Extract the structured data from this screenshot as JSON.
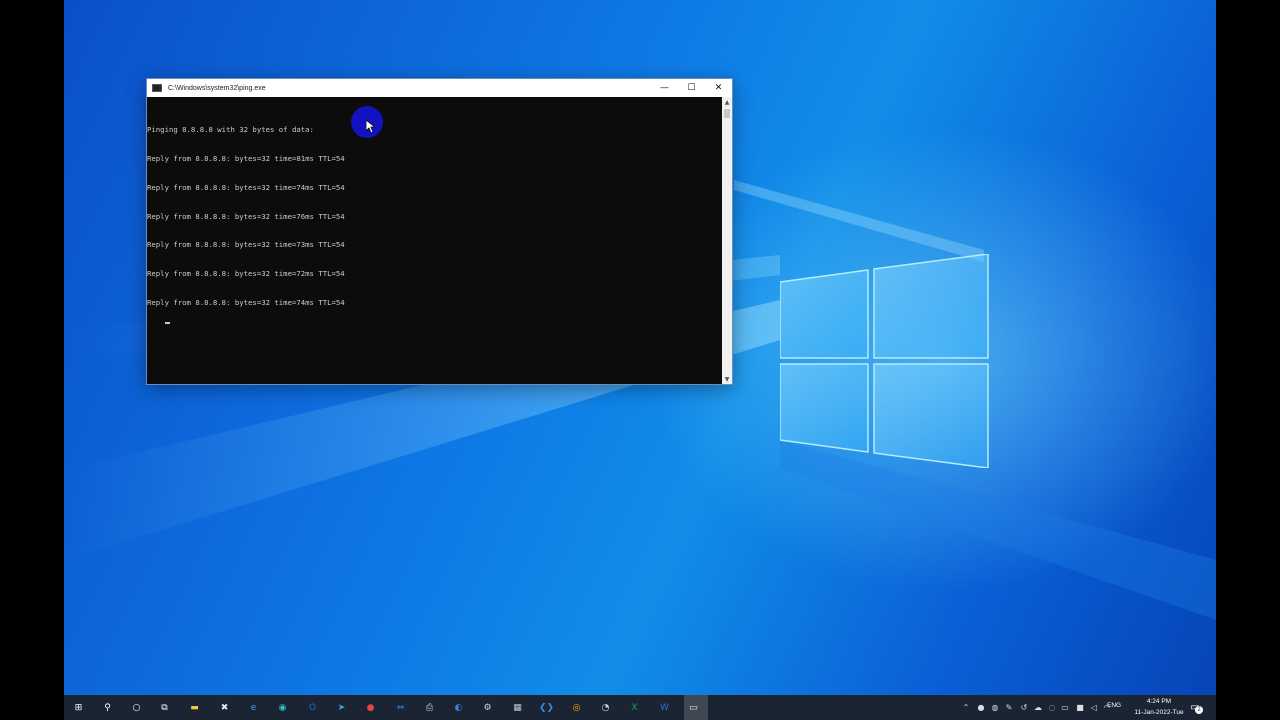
{
  "console": {
    "title": "C:\\Windows\\system32\\ping.exe",
    "minimize_glyph": "—",
    "maximize_glyph": "☐",
    "close_glyph": "✕",
    "lines": [
      "Pinging 8.8.8.8 with 32 bytes of data:",
      "Reply from 8.8.8.8: bytes=32 time=81ms TTL=54",
      "Reply from 8.8.8.8: bytes=32 time=74ms TTL=54",
      "Reply from 8.8.8.8: bytes=32 time=76ms TTL=54",
      "Reply from 8.8.8.8: bytes=32 time=73ms TTL=54",
      "Reply from 8.8.8.8: bytes=32 time=72ms TTL=54",
      "Reply from 8.8.8.8: bytes=32 time=74ms TTL=54"
    ],
    "colors": {
      "background": "#0c0c0c",
      "text": "#cccccc"
    }
  },
  "taskbar": {
    "apps": [
      {
        "name": "start-icon",
        "glyph": "⊞",
        "color": "#ffffff"
      },
      {
        "name": "search-icon",
        "glyph": "⚲",
        "color": "#ffffff"
      },
      {
        "name": "cortana-icon",
        "glyph": "○",
        "color": "#ffffff"
      },
      {
        "name": "task-view-icon",
        "glyph": "⧉",
        "color": "#ffffff"
      },
      {
        "name": "file-explorer-icon",
        "glyph": "▬",
        "color": "#f2c14e"
      },
      {
        "name": "tools-icon",
        "glyph": "✖",
        "color": "#e8e8e8"
      },
      {
        "name": "edge-legacy-icon",
        "glyph": "e",
        "color": "#3fa0ff"
      },
      {
        "name": "edge-icon",
        "glyph": "◉",
        "color": "#2bc4c9"
      },
      {
        "name": "outlook-icon",
        "glyph": "O",
        "color": "#1f6fd0"
      },
      {
        "name": "telegram-icon",
        "glyph": "➤",
        "color": "#35a7e0"
      },
      {
        "name": "recorder-icon",
        "glyph": "●",
        "color": "#e0473a"
      },
      {
        "name": "teamviewer-icon",
        "glyph": "⇔",
        "color": "#2a8cf0"
      },
      {
        "name": "printer-icon",
        "glyph": "⎙",
        "color": "#cfd6df"
      },
      {
        "name": "browser-icon",
        "glyph": "◐",
        "color": "#3d7fe0"
      },
      {
        "name": "settings-icon",
        "glyph": "⚙",
        "color": "#cfd6df"
      },
      {
        "name": "calculator-icon",
        "glyph": "▦",
        "color": "#bfc7d2"
      },
      {
        "name": "vscode-icon",
        "glyph": "❮❯",
        "color": "#2d8fe6"
      },
      {
        "name": "chrome-icon",
        "glyph": "◎",
        "color": "#f0b400"
      },
      {
        "name": "clock-app-icon",
        "glyph": "◔",
        "color": "#d8d8d8"
      },
      {
        "name": "excel-icon",
        "glyph": "X",
        "color": "#1f9d55"
      },
      {
        "name": "word-icon",
        "glyph": "W",
        "color": "#2f6fd6"
      },
      {
        "name": "console-icon",
        "glyph": "▭",
        "color": "#e8e8e8"
      }
    ],
    "tray_icons": [
      {
        "name": "tray-chevron-icon",
        "glyph": "⌃"
      },
      {
        "name": "microphone-icon",
        "glyph": "●"
      },
      {
        "name": "tray-app-icon",
        "glyph": "◍"
      },
      {
        "name": "tray-tool-icon",
        "glyph": "✎"
      },
      {
        "name": "tray-sync-icon",
        "glyph": "↺"
      },
      {
        "name": "tray-cloud-icon",
        "glyph": "☁"
      },
      {
        "name": "tray-network-icon",
        "glyph": "◌"
      },
      {
        "name": "tray-display-icon",
        "glyph": "▭"
      },
      {
        "name": "tray-record-icon",
        "glyph": "■"
      },
      {
        "name": "volume-icon",
        "glyph": "◁"
      },
      {
        "name": "tray-wifi-icon",
        "glyph": "◠"
      }
    ],
    "language": "ENG",
    "time": "4:24 PM",
    "date": "11-Jan-2022-Tue",
    "notifications_count": "2",
    "notification_glyph": "▭"
  }
}
